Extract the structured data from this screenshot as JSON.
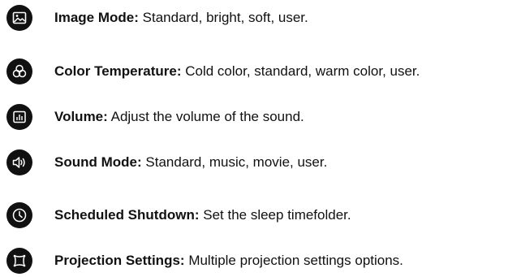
{
  "features": [
    {
      "icon": "image-icon",
      "label": "Image Mode:",
      "description": "Standard, bright, soft, user."
    },
    {
      "icon": "color-wheel-icon",
      "label": "Color Temperature:",
      "description": "Cold color, standard, warm color, user."
    },
    {
      "icon": "volume-bars-icon",
      "label": "Volume:",
      "description": "Adjust the volume of the sound."
    },
    {
      "icon": "speaker-icon",
      "label": "Sound Mode:",
      "description": "Standard, music, movie, user."
    },
    {
      "icon": "clock-icon",
      "label": "Scheduled Shutdown:",
      "description": "Set the sleep timefolder."
    },
    {
      "icon": "projection-icon",
      "label": "Projection Settings:",
      "description": "Multiple projection settings options."
    }
  ],
  "colors": {
    "icon_background": "#111111",
    "icon_foreground": "#ffffff",
    "text": "#111111"
  }
}
